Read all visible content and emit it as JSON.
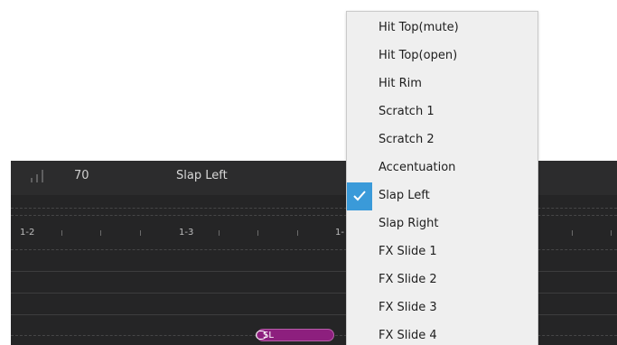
{
  "track": {
    "velocity": "70",
    "articulation": "Slap Left",
    "ruler_labels": [
      "1-2",
      "1-3",
      "1-"
    ],
    "note_label": "SL"
  },
  "menu": {
    "items": [
      {
        "label": "Hit Top(mute)",
        "checked": false
      },
      {
        "label": "Hit Top(open)",
        "checked": false
      },
      {
        "label": "Hit Rim",
        "checked": false
      },
      {
        "label": "Scratch 1",
        "checked": false
      },
      {
        "label": "Scratch 2",
        "checked": false
      },
      {
        "label": "Accentuation",
        "checked": false
      },
      {
        "label": "Slap Left",
        "checked": true
      },
      {
        "label": "Slap Right",
        "checked": false
      },
      {
        "label": "FX Slide 1",
        "checked": false
      },
      {
        "label": "FX Slide 2",
        "checked": false
      },
      {
        "label": "FX Slide 3",
        "checked": false
      },
      {
        "label": "FX Slide 4",
        "checked": false
      }
    ]
  },
  "colors": {
    "note": "#8d1f7e",
    "check_accent": "#3a9ad9",
    "panel_bg": "#252526",
    "menu_bg": "#efefef"
  }
}
